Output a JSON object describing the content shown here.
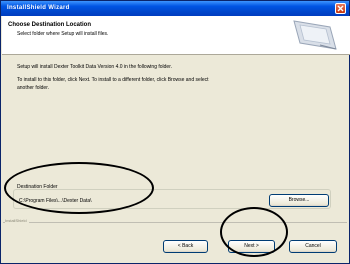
{
  "window": {
    "title": "InstallShield Wizard"
  },
  "header": {
    "title": "Choose Destination Location",
    "subtitle": "Select folder where Setup will install files."
  },
  "body": {
    "line1": "Setup will install Dexter Toolkit Data Version 4.0 in the following folder.",
    "line2": "To install to this folder, click Next. To install to a different folder, click Browse and select",
    "line3": "another folder."
  },
  "destination": {
    "group_label": "Destination Folder",
    "path": "C:\\Program Files\\...\\Dexter Data\\",
    "browse_label": "Browse..."
  },
  "footer": {
    "brand": "InstallShield",
    "back_label": "< Back",
    "next_label": "Next >",
    "cancel_label": "Cancel"
  },
  "colors": {
    "titlebar": "#0054e3",
    "dialog": "#ece9d8",
    "button_border": "#003c74"
  },
  "icons": {
    "close": "close-icon",
    "header_graphic": "computer-icon"
  }
}
